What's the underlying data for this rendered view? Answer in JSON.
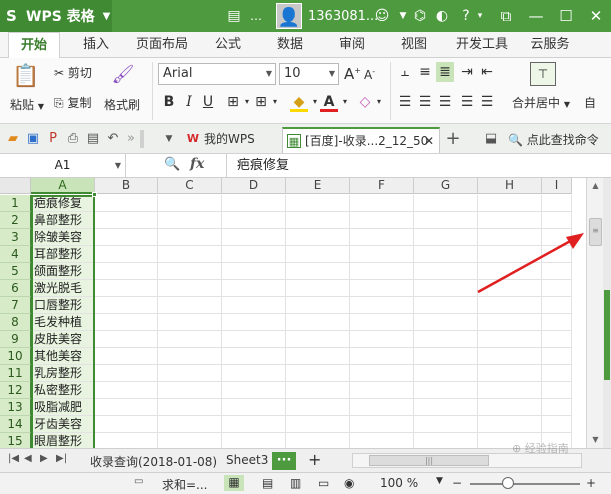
{
  "titlebar": {
    "app_name": "WPS 表格",
    "account": "1363081...",
    "colors": {
      "brand": "#4d9a3f",
      "brand_dark": "#3f8a32"
    }
  },
  "menu_tabs": [
    {
      "label": "开始",
      "active": true
    },
    {
      "label": "插入"
    },
    {
      "label": "页面布局"
    },
    {
      "label": "公式"
    },
    {
      "label": "数据"
    },
    {
      "label": "审阅"
    },
    {
      "label": "视图"
    },
    {
      "label": "开发工具"
    },
    {
      "label": "云服务"
    }
  ],
  "ribbon": {
    "paste": "粘贴",
    "cut": "剪切",
    "copy": "复制",
    "format_painter": "格式刷",
    "font_name": "Arial",
    "font_size": "10",
    "merge_center": "合并居中",
    "auto_wrap_partial": "自"
  },
  "quickbar": {
    "tabs": [
      {
        "label": "我的WPS"
      },
      {
        "label": "[百度]-收录...2_12_50",
        "active": true
      }
    ],
    "search": "点此查找命令"
  },
  "formula_bar": {
    "cell_ref": "A1",
    "fx": "fx",
    "content": "疤痕修复"
  },
  "grid": {
    "columns": [
      "A",
      "B",
      "C",
      "D",
      "E",
      "F",
      "G",
      "H",
      "I"
    ],
    "rows": [
      {
        "num": "1",
        "a": "疤痕修复"
      },
      {
        "num": "2",
        "a": "鼻部整形"
      },
      {
        "num": "3",
        "a": "除皱美容"
      },
      {
        "num": "4",
        "a": "耳部整形"
      },
      {
        "num": "5",
        "a": "颌面整形"
      },
      {
        "num": "6",
        "a": "激光脱毛"
      },
      {
        "num": "7",
        "a": "口唇整形"
      },
      {
        "num": "8",
        "a": "毛发种植"
      },
      {
        "num": "9",
        "a": "皮肤美容"
      },
      {
        "num": "10",
        "a": "其他美容"
      },
      {
        "num": "11",
        "a": "乳房整形"
      },
      {
        "num": "12",
        "a": "私密整形"
      },
      {
        "num": "13",
        "a": "吸脂减肥"
      },
      {
        "num": "14",
        "a": "牙齿美容"
      },
      {
        "num": "15",
        "a": "眼眉整形"
      }
    ]
  },
  "sheetbar": {
    "sheet1": "收录查询(2018-01-08)",
    "sheet2": "Sheet3",
    "more": "···",
    "add": "+"
  },
  "statusbar": {
    "sum": "求和=...",
    "zoom": "100 %",
    "minus": "−",
    "plus": "+"
  }
}
